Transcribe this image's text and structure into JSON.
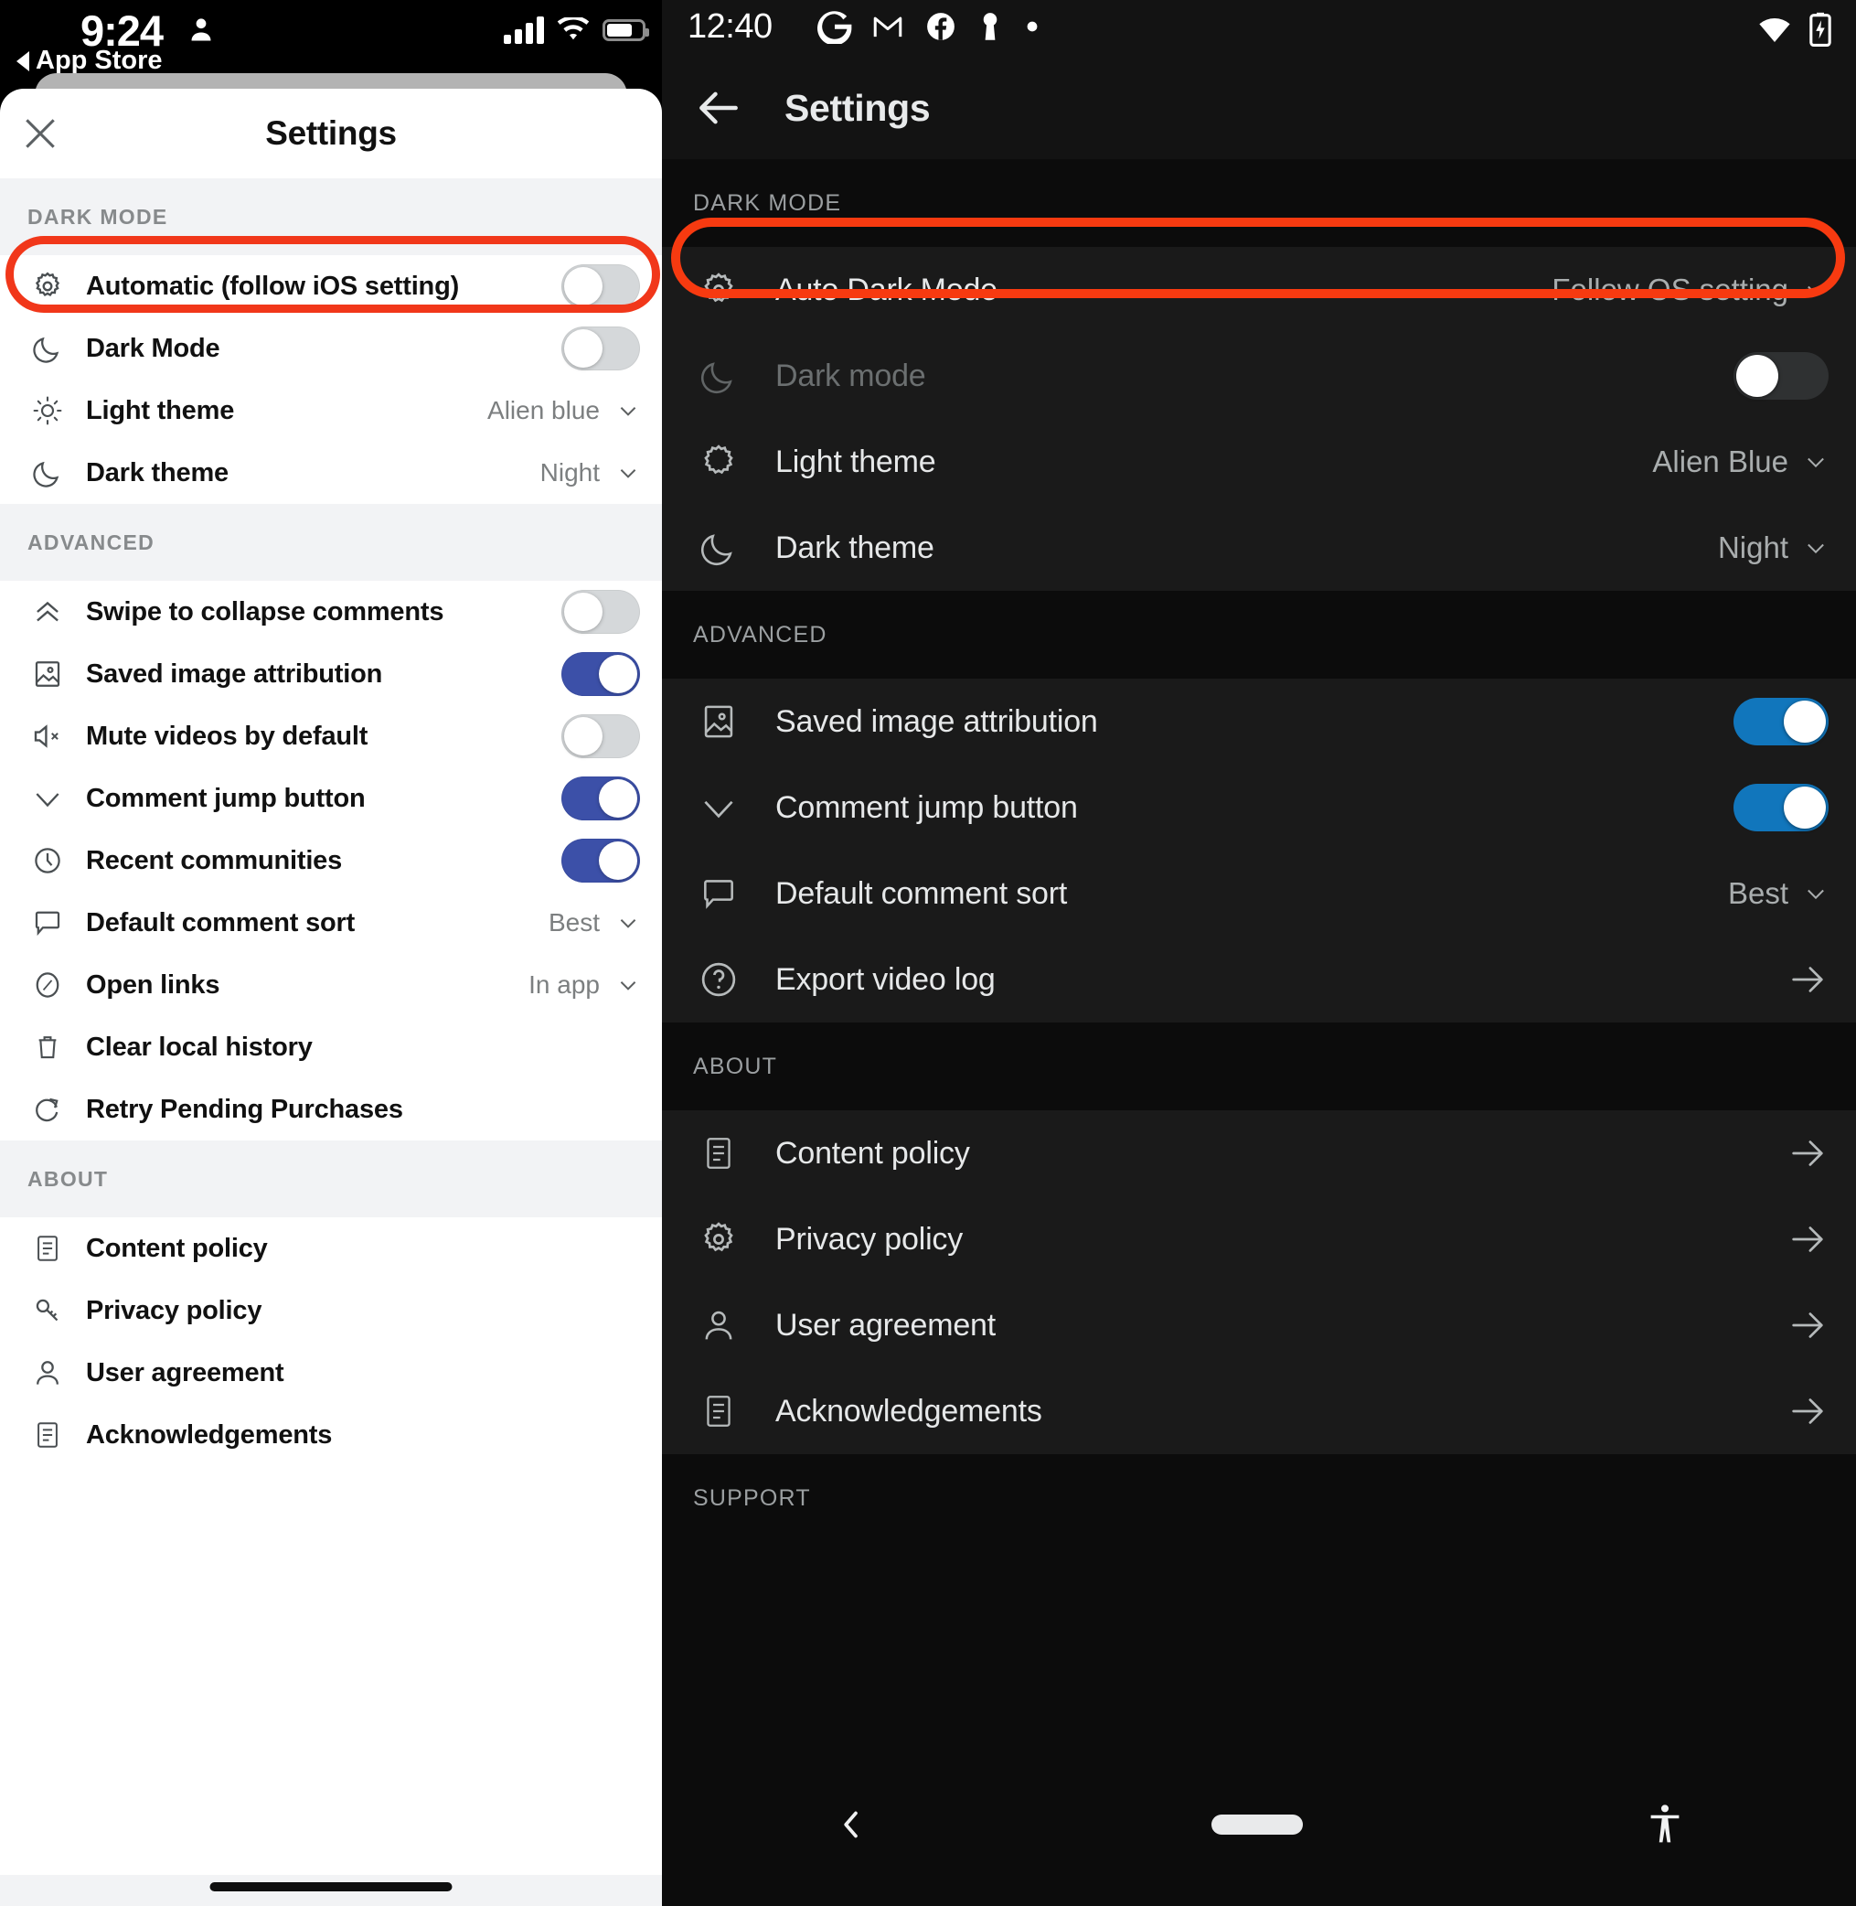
{
  "ios": {
    "status": {
      "time": "9:24",
      "back_app": "App Store"
    },
    "header": {
      "title": "Settings",
      "close_icon": "close-icon"
    },
    "sections": [
      {
        "label": "DARK MODE",
        "rows": [
          {
            "icon": "gear-icon",
            "label": "Automatic (follow iOS setting)",
            "control": "toggle",
            "toggle": "off",
            "highlighted": true
          },
          {
            "icon": "moon-icon",
            "label": "Dark Mode",
            "control": "toggle",
            "toggle": "off"
          },
          {
            "icon": "sun-icon",
            "label": "Light theme",
            "control": "value",
            "value": "Alien blue"
          },
          {
            "icon": "moon-icon",
            "label": "Dark theme",
            "control": "value",
            "value": "Night"
          }
        ]
      },
      {
        "label": "ADVANCED",
        "rows": [
          {
            "icon": "chevrons-up-icon",
            "label": "Swipe to collapse comments",
            "control": "toggle",
            "toggle": "off"
          },
          {
            "icon": "image-icon",
            "label": "Saved image attribution",
            "control": "toggle",
            "toggle": "on"
          },
          {
            "icon": "mute-icon",
            "label": "Mute videos by default",
            "control": "toggle",
            "toggle": "off"
          },
          {
            "icon": "chevron-down-icon",
            "label": "Comment jump button",
            "control": "toggle",
            "toggle": "on"
          },
          {
            "icon": "clock-icon",
            "label": "Recent communities",
            "control": "toggle",
            "toggle": "on"
          },
          {
            "icon": "comment-icon",
            "label": "Default comment sort",
            "control": "value",
            "value": "Best"
          },
          {
            "icon": "compass-icon",
            "label": "Open links",
            "control": "value",
            "value": "In app"
          },
          {
            "icon": "trash-icon",
            "label": "Clear local history",
            "control": "none"
          },
          {
            "icon": "refresh-icon",
            "label": "Retry Pending Purchases",
            "control": "none"
          }
        ]
      },
      {
        "label": "ABOUT",
        "rows": [
          {
            "icon": "document-icon",
            "label": "Content policy",
            "control": "none"
          },
          {
            "icon": "key-icon",
            "label": "Privacy policy",
            "control": "none"
          },
          {
            "icon": "person-icon",
            "label": "User agreement",
            "control": "none"
          },
          {
            "icon": "document-icon",
            "label": "Acknowledgements",
            "control": "none"
          }
        ]
      }
    ]
  },
  "android": {
    "status": {
      "time": "12:40",
      "icons": [
        "google-icon",
        "gmail-icon",
        "facebook-icon",
        "keyhole-icon",
        "dot-icon"
      ],
      "right_icons": [
        "wifi-icon",
        "battery-charging-icon"
      ]
    },
    "header": {
      "title": "Settings",
      "back_icon": "arrow-left-icon"
    },
    "sections": [
      {
        "label": "DARK MODE",
        "rows": [
          {
            "icon": "gear-icon",
            "label": "Auto Dark Mode",
            "control": "value",
            "value": "Follow OS setting",
            "highlighted": true
          },
          {
            "icon": "moon-icon",
            "label": "Dark mode",
            "control": "toggle",
            "toggle": "off",
            "disabled": true
          },
          {
            "icon": "starburst-icon",
            "label": "Light theme",
            "control": "value",
            "value": "Alien Blue"
          },
          {
            "icon": "moon-icon",
            "label": "Dark theme",
            "control": "value",
            "value": "Night"
          }
        ]
      },
      {
        "label": "ADVANCED",
        "rows": [
          {
            "icon": "image-icon",
            "label": "Saved image attribution",
            "control": "toggle",
            "toggle": "on"
          },
          {
            "icon": "chevron-down-icon",
            "label": "Comment jump button",
            "control": "toggle",
            "toggle": "on"
          },
          {
            "icon": "comment-icon",
            "label": "Default comment sort",
            "control": "value",
            "value": "Best"
          },
          {
            "icon": "question-circle-icon",
            "label": "Export video log",
            "control": "arrow"
          }
        ]
      },
      {
        "label": "ABOUT",
        "rows": [
          {
            "icon": "document-icon",
            "label": "Content policy",
            "control": "arrow"
          },
          {
            "icon": "gear-icon",
            "label": "Privacy policy",
            "control": "arrow"
          },
          {
            "icon": "person-icon",
            "label": "User agreement",
            "control": "arrow"
          },
          {
            "icon": "document-icon",
            "label": "Acknowledgements",
            "control": "arrow"
          }
        ]
      },
      {
        "label": "SUPPORT",
        "rows": []
      }
    ],
    "navbar": {
      "back_icon": "nav-back-icon",
      "home_icon": "nav-home-pill",
      "accessibility_icon": "accessibility-icon"
    }
  },
  "colors": {
    "highlight_ios": "#f1371a",
    "highlight_android": "#f73a10",
    "toggle_on_ios": "#3c50a8",
    "toggle_on_android": "#1176bc"
  }
}
